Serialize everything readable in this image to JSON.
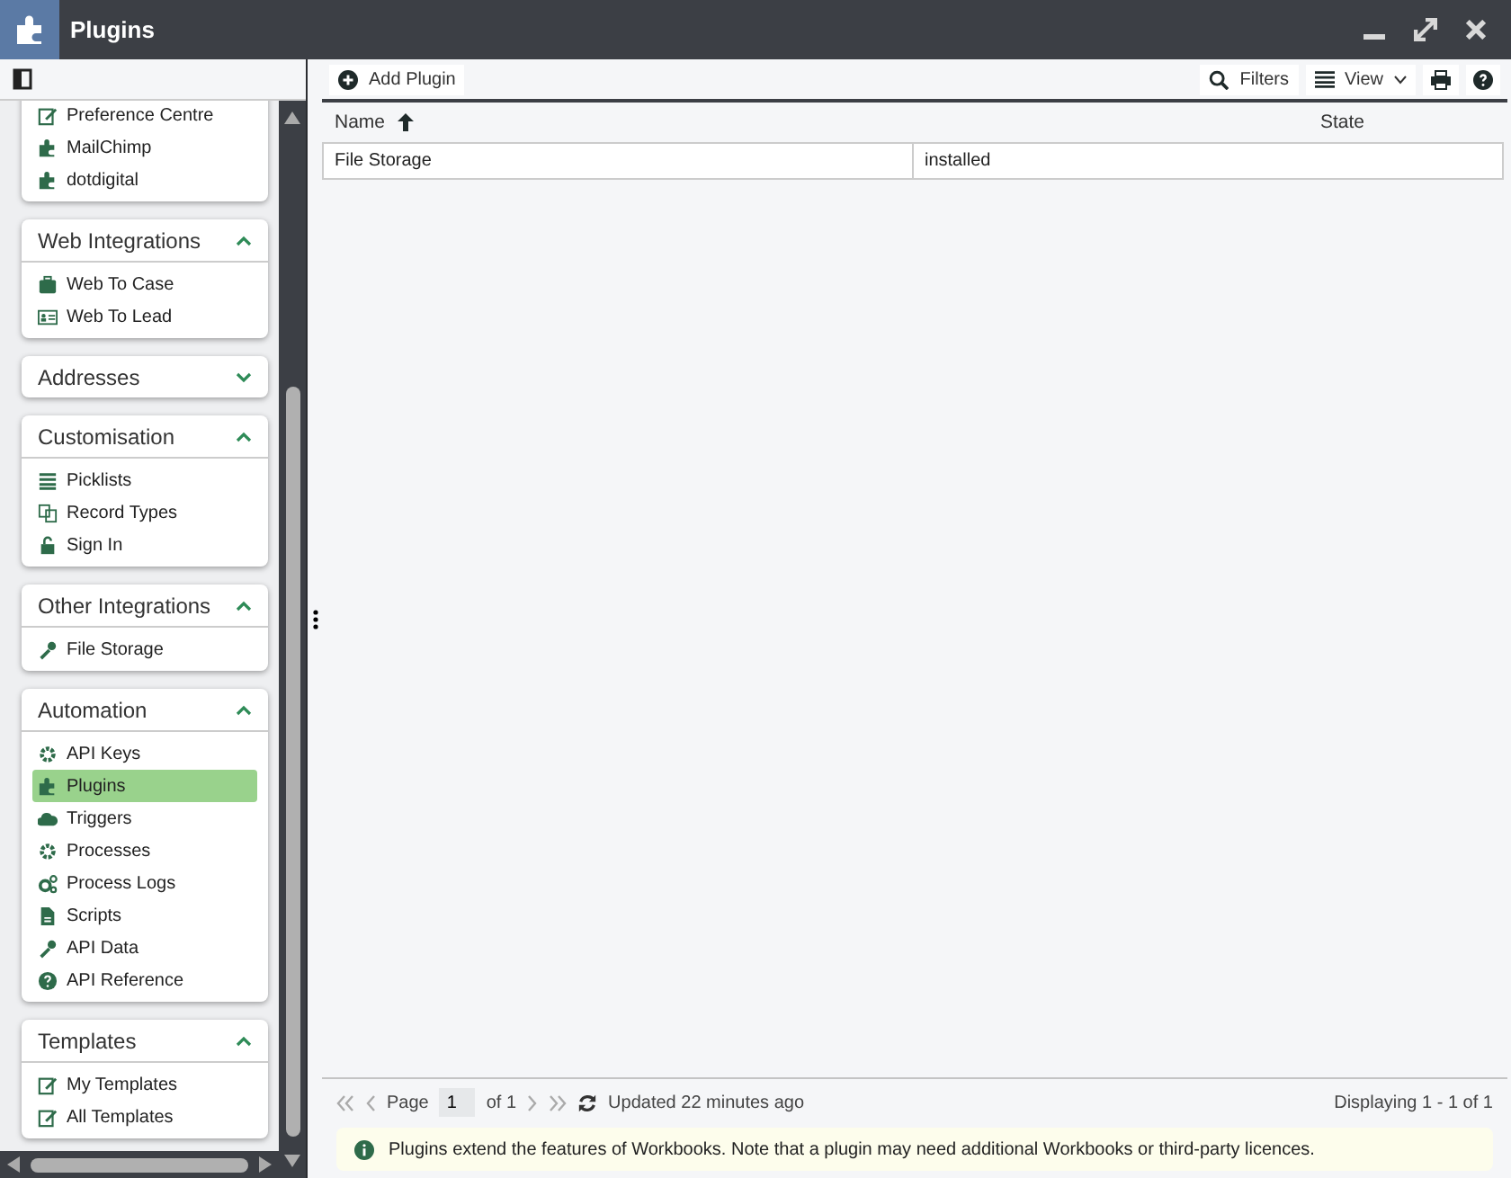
{
  "window": {
    "title": "Plugins"
  },
  "sidebar": {
    "groups": [
      {
        "items": [
          {
            "label": "Preference Centre",
            "selected": false
          },
          {
            "label": "MailChimp",
            "selected": false
          },
          {
            "label": "dotdigital",
            "selected": false
          }
        ]
      },
      {
        "title": "Web Integrations",
        "expanded": true,
        "items": [
          {
            "label": "Web To Case",
            "selected": false
          },
          {
            "label": "Web To Lead",
            "selected": false
          }
        ]
      },
      {
        "title": "Addresses",
        "expanded": false
      },
      {
        "title": "Customisation",
        "expanded": true,
        "items": [
          {
            "label": "Picklists",
            "selected": false
          },
          {
            "label": "Record Types",
            "selected": false
          },
          {
            "label": "Sign In",
            "selected": false
          }
        ]
      },
      {
        "title": "Other Integrations",
        "expanded": true,
        "items": [
          {
            "label": "File Storage",
            "selected": false
          }
        ]
      },
      {
        "title": "Automation",
        "expanded": true,
        "items": [
          {
            "label": "API Keys",
            "selected": false
          },
          {
            "label": "Plugins",
            "selected": true
          },
          {
            "label": "Triggers",
            "selected": false
          },
          {
            "label": "Processes",
            "selected": false
          },
          {
            "label": "Process Logs",
            "selected": false
          },
          {
            "label": "Scripts",
            "selected": false
          },
          {
            "label": "API Data",
            "selected": false
          },
          {
            "label": "API Reference",
            "selected": false
          }
        ]
      },
      {
        "title": "Templates",
        "expanded": true,
        "items": [
          {
            "label": "My Templates",
            "selected": false
          },
          {
            "label": "All Templates",
            "selected": false
          }
        ]
      }
    ]
  },
  "toolbar": {
    "add_button": "Add Plugin",
    "filters": "Filters",
    "view": "View"
  },
  "table": {
    "columns": [
      {
        "label": "Name",
        "sorted": true
      },
      {
        "label": "State",
        "sorted": false
      }
    ],
    "rows": [
      [
        "File Storage",
        "installed"
      ]
    ]
  },
  "pager": {
    "page_label": "Page",
    "page": "1",
    "of": "of 1",
    "updated": "Updated 22 minutes ago",
    "displaying": "Displaying 1 - 1 of 1"
  },
  "info": "Plugins extend the features of Workbooks. Note that a plugin may need additional Workbooks or third-party licences."
}
